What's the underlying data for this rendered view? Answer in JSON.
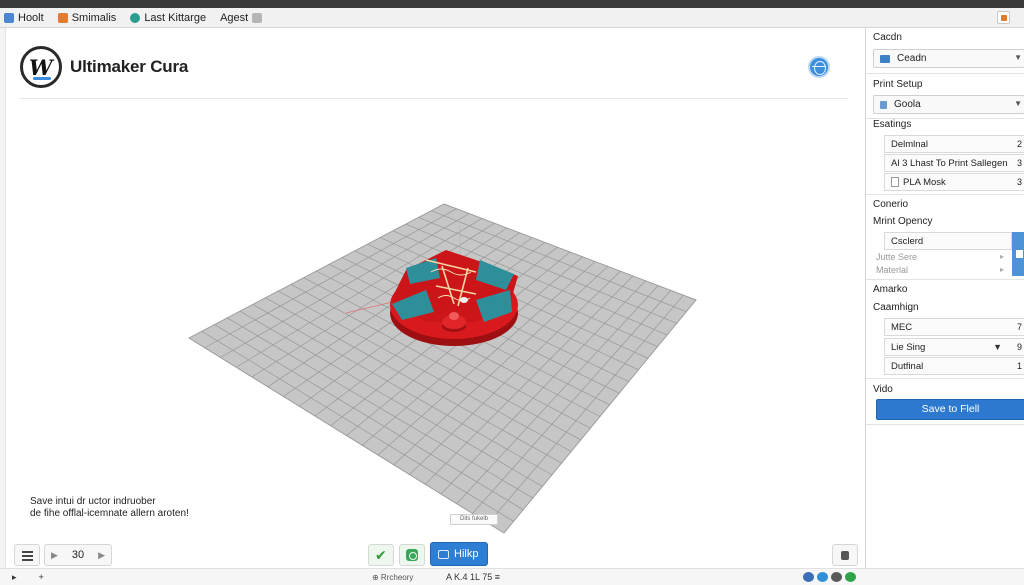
{
  "tabs": [
    {
      "label": "Hoolt",
      "color": "#4a86d4"
    },
    {
      "label": "Smimalis",
      "color": "#e37b33"
    },
    {
      "label": "Last Kittarge",
      "color": "#2a9d8f"
    },
    {
      "label": "Agest",
      "color": "#9a9a9a"
    }
  ],
  "header": {
    "app_name": "Ultimaker Cura"
  },
  "viewport": {
    "message_line1": "Save intui dr uctor indruober",
    "message_line2": "de fihe offlal-icemnate allern aroten!",
    "tooltip": "Dits fukelb"
  },
  "toolbar": {
    "layer_value": "30",
    "help_label": "Hilkp"
  },
  "sidebar": {
    "s1_title": "Cacdn",
    "s1_dropdown": "Ceadn",
    "s2_title": "Print Setup",
    "s2_dropdown": "Goola",
    "s3_title": "Esatings",
    "s3_rows": [
      {
        "label": "Delmlnal",
        "value": "2"
      },
      {
        "label": "Al 3 Lhast To Print Sallegen",
        "value": "3"
      },
      {
        "label": "PLA Mosk",
        "value": "3"
      }
    ],
    "s4_title": "Conerio",
    "s4_sub_title": "Mrint Opency",
    "s4_dropdown": "Csclerd",
    "s4_item1": "Jutte Sere",
    "s4_item2": "Materlal",
    "s5_title": "Amarko",
    "s5_sub_title": "Caamhign",
    "s5_rows": [
      {
        "label": "MEC",
        "value": "7"
      },
      {
        "label": "Lie Sing",
        "value": "9"
      },
      {
        "label": "Dutfinal",
        "value": "1"
      }
    ],
    "s6_title": "Vido",
    "save_button": "Save to Flell"
  },
  "status": {
    "left_a": "▸",
    "left_b": "+",
    "mid": "⊕ Rrcheory",
    "mid2": "A  K.4   1L 75  ≡"
  },
  "colors": {
    "accent": "#2c79cf",
    "model_red": "#d8191d",
    "model_teal": "#2e8f9a",
    "plate": "#c9c9c9"
  }
}
